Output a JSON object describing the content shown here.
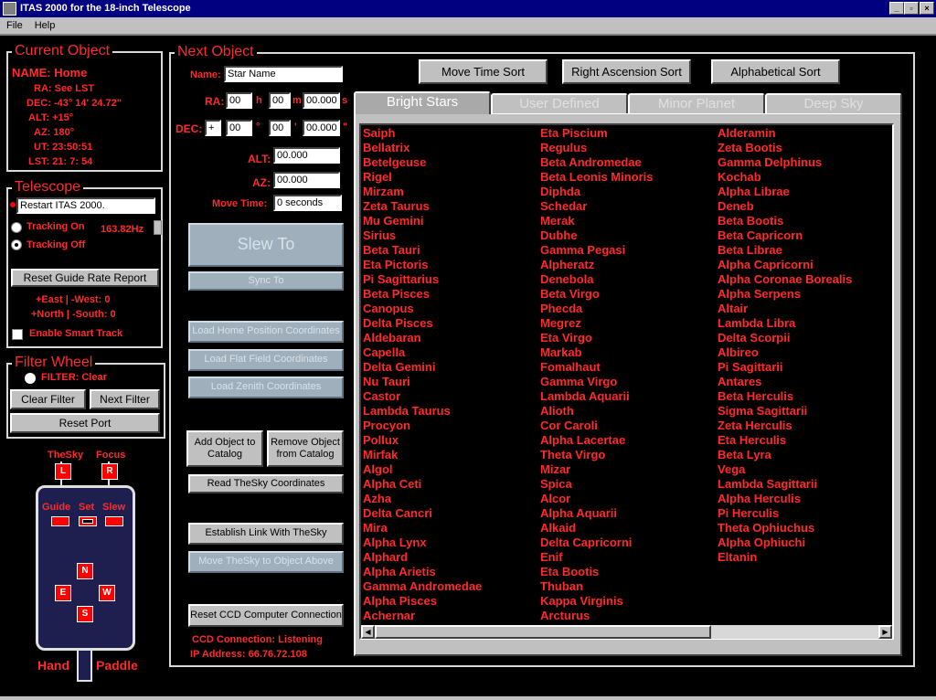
{
  "window": {
    "title": "ITAS 2000 for the 18-inch Telescope"
  },
  "menu": {
    "items": [
      "File",
      "Help"
    ]
  },
  "current_object": {
    "title": "Current Object",
    "name": "NAME: Home",
    "ra": "RA: See LST",
    "dec": "DEC: -43° 14' 24.72\"",
    "alt": "ALT: +15°",
    "az": "AZ: 180°",
    "ut": "UT: 23:50:51",
    "lst": "LST:  21: 7: 54"
  },
  "telescope": {
    "title": "Telescope",
    "status_value": "Restart ITAS 2000.",
    "tracking_on": "Tracking On",
    "tracking_rate": "163.82Hz",
    "tracking_off": "Tracking Off",
    "reset_guide": "Reset Guide Rate Report",
    "east_west": "+East | -West:  0",
    "north_south": "+North | -South:  0",
    "smart_track": "Enable Smart Track"
  },
  "filter_wheel": {
    "title": "Filter Wheel",
    "filter": "FILTER: Clear",
    "clear": "Clear Filter",
    "next": "Next Filter",
    "reset": "Reset Port"
  },
  "paddle": {
    "thesky": "TheSky",
    "focus": "Focus",
    "l": "L",
    "r": "R",
    "guide": "Guide",
    "set": "Set",
    "slew": "Slew",
    "n": "N",
    "e": "E",
    "w": "W",
    "s": "S",
    "hand": "Hand",
    "paddle": "Paddle"
  },
  "next_object": {
    "title": "Next Object",
    "name_label": "Name:",
    "name_value": "Star Name",
    "ra_label": "RA:",
    "ra_h": "00",
    "ra_h_unit": "h",
    "ra_m": "00",
    "ra_m_unit": "m",
    "ra_s": "00.000",
    "ra_s_unit": "s",
    "dec_label": "DEC:",
    "dec_sign": "+",
    "dec_d": "00",
    "dec_d_unit": "°",
    "dec_m": "00",
    "dec_m_unit": "'",
    "dec_s": "00.000",
    "dec_s_unit": "\"",
    "alt_label": "ALT:",
    "alt_value": "00.000",
    "az_label": "AZ:",
    "az_value": "00.000",
    "move_label": "Move Time:",
    "move_value": "0 seconds",
    "slew_to": "Slew To",
    "sync_to": "Sync To",
    "load_home": "Load Home Position Coordinates",
    "load_flat": "Load Flat Field Coordinates",
    "load_zenith": "Load Zenith Coordinates",
    "add_catalog": "Add Object to Catalog",
    "remove_catalog": "Remove Object from Catalog",
    "read_thesky": "Read TheSky Coordinates",
    "establish_link": "Establish Link With TheSky",
    "move_thesky": "Move TheSky to Object Above",
    "reset_ccd": "Reset CCD Computer Connection",
    "ccd_status": "CCD Connection:  Listening",
    "ip": "IP Address:  66.76.72.108"
  },
  "sort_buttons": [
    "Move Time Sort",
    "Right Ascension Sort",
    "Alphabetical Sort"
  ],
  "tabs": [
    "Bright Stars",
    "User Defined",
    "Minor Planet",
    "Deep Sky"
  ],
  "stars": {
    "col1": [
      "Saiph",
      "Bellatrix",
      "Betelgeuse",
      "Rigel",
      "Mirzam",
      "Zeta Taurus",
      "Mu Gemini",
      "Sirius",
      "Beta Tauri",
      "Eta Pictoris",
      "Pi Sagittarius",
      "Beta Pisces",
      "Canopus",
      "Delta Pisces",
      "Aldebaran",
      "Capella",
      "Delta Gemini",
      "Nu Tauri",
      "Castor",
      "Lambda Taurus",
      "Procyon",
      "Pollux",
      "Mirfak",
      "Algol",
      "Alpha Ceti",
      "Azha",
      "Delta Cancri",
      "Mira",
      "Alpha Lynx",
      "Alphard",
      "Alpha Arietis",
      "Gamma Andromedae",
      "Alpha Pisces",
      "Achernar"
    ],
    "col2": [
      "Eta Piscium",
      "Regulus",
      "Beta Andromedae",
      "Beta Leonis Minoris",
      "Diphda",
      "Schedar",
      "Merak",
      "Dubhe",
      "Gamma Pegasi",
      "Alpheratz",
      "Denebola",
      "Beta Virgo",
      "Phecda",
      "Megrez",
      "Eta Virgo",
      "Markab",
      "Fomalhaut",
      "Gamma Virgo",
      "Lambda Aquarii",
      "Alioth",
      "Cor Caroli",
      "Alpha Lacertae",
      "Theta Virgo",
      "Mizar",
      "Spica",
      "Alcor",
      "Alpha Aquarii",
      "Alkaid",
      "Delta Capricorni",
      "Enif",
      "Eta Bootis",
      "Thuban",
      "Kappa Virginis",
      "Arcturus"
    ],
    "col3": [
      "Alderamin",
      "Zeta Bootis",
      "Gamma Delphinus",
      "Kochab",
      "Alpha Librae",
      "Deneb",
      "Beta Bootis",
      "Beta Capricorn",
      "Beta Librae",
      "Alpha Capricorni",
      "Alpha Coronae Borealis",
      "Alpha Serpens",
      "Altair",
      "Lambda Libra",
      "Delta Scorpii",
      "Albireo",
      "Pi Sagittarii",
      "Antares",
      "Beta Herculis",
      "Sigma Sagittarii",
      "Zeta Herculis",
      "Eta Herculis",
      "Beta Lyra",
      "Vega",
      "Lambda Sagittarii",
      "Alpha Herculis",
      "Pi Herculis",
      "Theta Ophiuchus",
      "Alpha Ophiuchi",
      "Eltanin"
    ]
  }
}
